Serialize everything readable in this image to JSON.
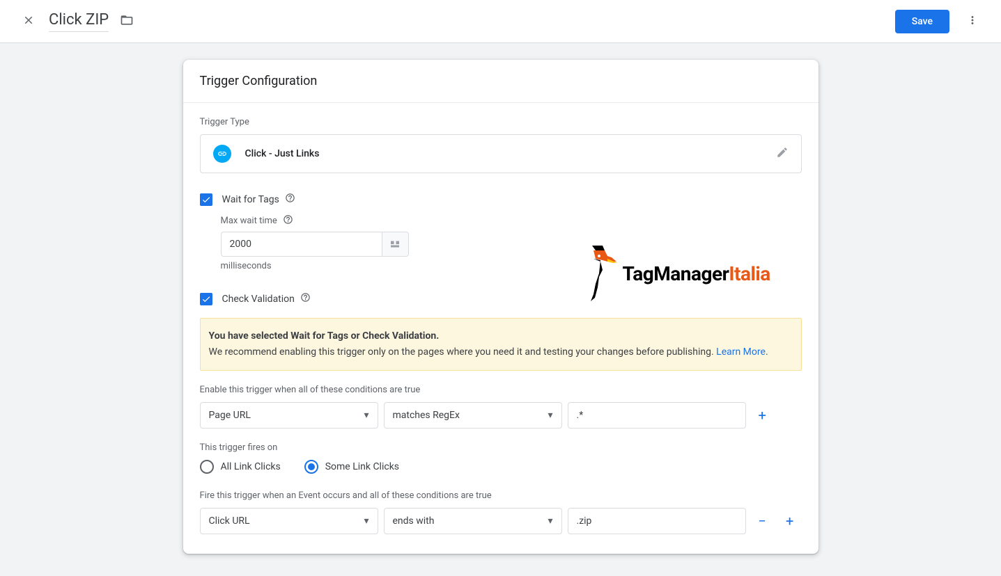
{
  "header": {
    "title": "Click ZIP",
    "save_label": "Save"
  },
  "card": {
    "title": "Trigger Configuration",
    "trigger_type_label": "Trigger Type",
    "trigger_type_value": "Click - Just Links",
    "wait_tags_label": "Wait for Tags",
    "max_wait_label": "Max wait time",
    "max_wait_value": "2000",
    "ms_label": "milliseconds",
    "check_validation_label": "Check Validation",
    "warn_title": "You have selected Wait for Tags or Check Validation.",
    "warn_body": "We recommend enabling this trigger only on the pages where you need it and testing your changes before publishing. ",
    "learn_more": "Learn More",
    "enable_cond_label": "Enable this trigger when all of these conditions are true",
    "cond1_var": "Page URL",
    "cond1_op": "matches RegEx",
    "cond1_val": ".*",
    "fires_on_label": "This trigger fires on",
    "radio_all": "All Link Clicks",
    "radio_some": "Some Link Clicks",
    "fire_cond_label": "Fire this trigger when an Event occurs and all of these conditions are true",
    "cond2_var": "Click URL",
    "cond2_op": "ends with",
    "cond2_val": ".zip"
  },
  "logo": {
    "brand1": "TagManager",
    "brand2": "Italia"
  }
}
